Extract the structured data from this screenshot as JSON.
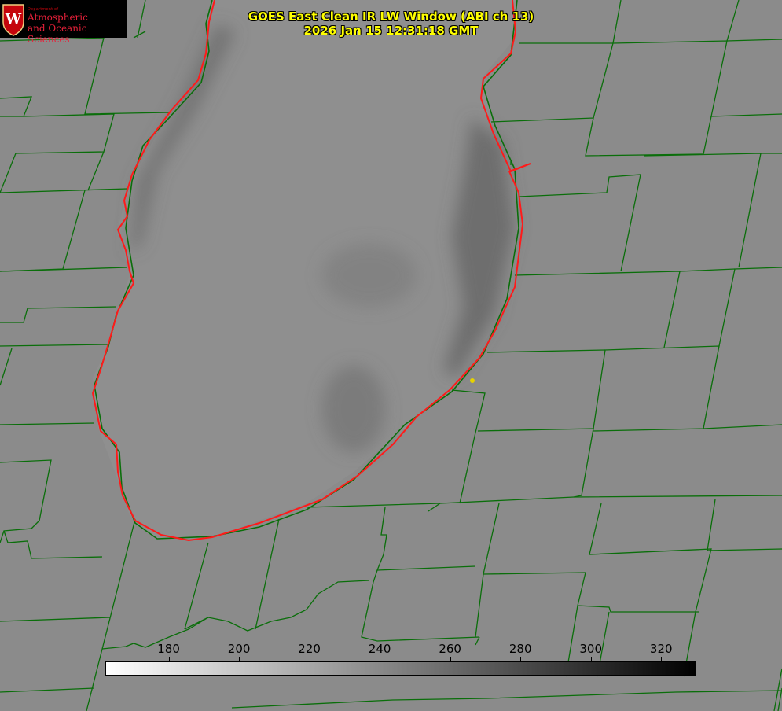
{
  "title": {
    "line1": "GOES East Clean IR LW Window (ABI ch 13)",
    "line2": "2026 Jan 15 12:31:18 GMT"
  },
  "logo": {
    "dept": "Department of",
    "line1": "Atmospheric",
    "line2": "and Oceanic Sciences",
    "crest_letter": "W"
  },
  "colorbar": {
    "min": 162,
    "max": 330,
    "ticks": [
      "180",
      "200",
      "220",
      "240",
      "260",
      "280",
      "300",
      "320"
    ]
  },
  "colors": {
    "lake_outline": "#ff1a1a",
    "boundaries": "#0a6e0a",
    "marker": "#e6d200",
    "title": "#ffff00"
  }
}
